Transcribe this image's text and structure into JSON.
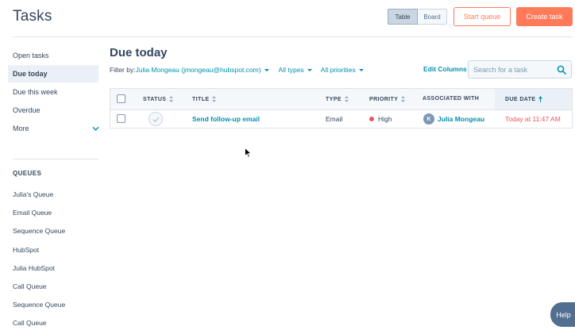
{
  "header": {
    "title": "Tasks",
    "view_toggle": {
      "table": "Table",
      "board": "Board",
      "selected": "Table"
    },
    "start_queue_label": "Start queue",
    "create_task_label": "Create task"
  },
  "sidebar": {
    "items": [
      {
        "label": "Open tasks"
      },
      {
        "label": "Due today"
      },
      {
        "label": "Due this week"
      },
      {
        "label": "Overdue"
      },
      {
        "label": "More"
      }
    ],
    "active_item": "Due today",
    "queues_heading": "QUEUES",
    "queues": [
      {
        "label": "Julia's Queue"
      },
      {
        "label": "Email Queue"
      },
      {
        "label": "Sequence Queue"
      },
      {
        "label": "HubSpot"
      },
      {
        "label": "Julia HubSpot"
      },
      {
        "label": "Call Queue"
      },
      {
        "label": "Sequence Queue"
      },
      {
        "label": "Call Queue"
      }
    ]
  },
  "main": {
    "title": "Due today",
    "filter": {
      "label": "Filter by:",
      "owner": "Julia Mongeau (jmongeau@hubspot.com)",
      "types": "All types",
      "priorities": "All priorities"
    },
    "edit_columns_label": "Edit Columns",
    "search": {
      "placeholder": "Search for a task",
      "value": ""
    },
    "table": {
      "columns": [
        "STATUS",
        "TITLE",
        "TYPE",
        "PRIORITY",
        "ASSOCIATED WITH",
        "DUE DATE"
      ],
      "sorted_column": "DUE DATE",
      "rows": [
        {
          "status": "not completed",
          "title": "Send follow-up email",
          "type": "Email",
          "priority": "High",
          "associated_initial": "K",
          "associated_with": "Julia Mongeau",
          "due_date": "Today at 11:47 AM"
        }
      ]
    }
  },
  "help_label": "Help",
  "colors": {
    "accent_orange": "#ff7a59",
    "link_teal": "#0091ae",
    "text_dark": "#33475b",
    "priority_high": "#f2545b",
    "due_today_red": "#f2545b"
  }
}
